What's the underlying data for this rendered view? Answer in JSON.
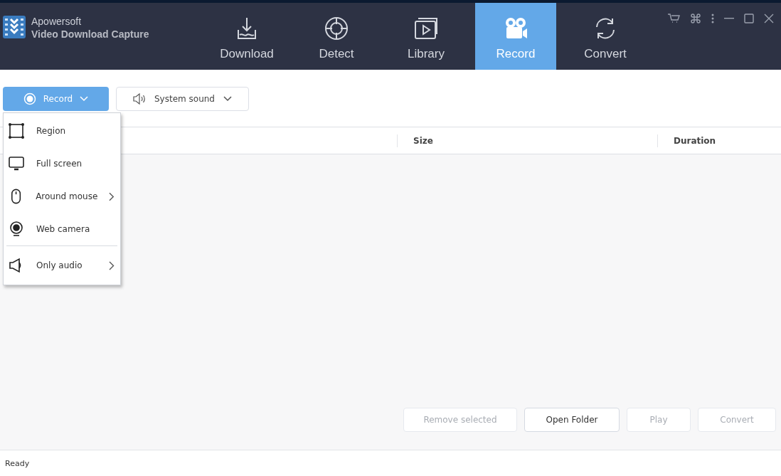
{
  "app": {
    "brand": "Apowersoft",
    "product": "Video Download Capture"
  },
  "tabs": [
    {
      "label": "Download",
      "selected": false
    },
    {
      "label": "Detect",
      "selected": false
    },
    {
      "label": "Library",
      "selected": false
    },
    {
      "label": "Record",
      "selected": true
    },
    {
      "label": "Convert",
      "selected": false
    }
  ],
  "toolbar": {
    "record_button": "Record",
    "audio_dropdown": "System sound"
  },
  "record_menu": {
    "open": true,
    "items": [
      {
        "label": "Region",
        "submenu": false,
        "separator_before": false
      },
      {
        "label": "Full screen",
        "submenu": false,
        "separator_before": false
      },
      {
        "label": "Around mouse",
        "submenu": true,
        "separator_before": false
      },
      {
        "label": "Web camera",
        "submenu": false,
        "separator_before": false
      },
      {
        "label": "Only audio",
        "submenu": true,
        "separator_before": true
      }
    ]
  },
  "table": {
    "columns": [
      "Size",
      "Duration"
    ]
  },
  "actions": [
    {
      "label": "Remove selected",
      "disabled": true
    },
    {
      "label": "Open Folder",
      "disabled": false
    },
    {
      "label": "Play",
      "disabled": true
    },
    {
      "label": "Convert",
      "disabled": true
    }
  ],
  "status_bar": "Ready"
}
